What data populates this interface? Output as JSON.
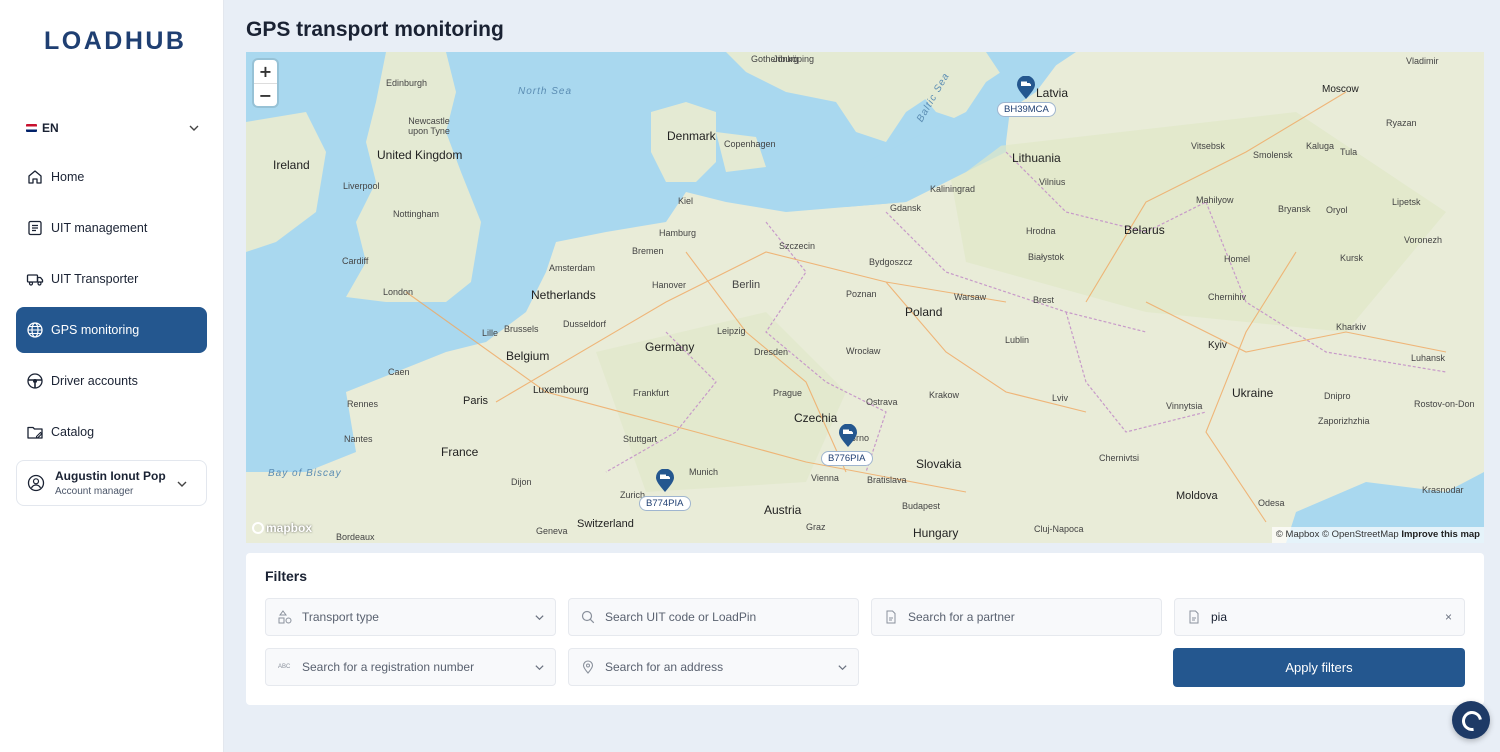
{
  "app": {
    "logo": "LOADHUB"
  },
  "language": {
    "code": "EN"
  },
  "nav": {
    "items": [
      {
        "label": "Home",
        "icon": "home-icon"
      },
      {
        "label": "UIT management",
        "icon": "document-list-icon"
      },
      {
        "label": "UIT Transporter",
        "icon": "truck-icon"
      },
      {
        "label": "GPS monitoring",
        "icon": "globe-icon",
        "active": true
      },
      {
        "label": "Driver accounts",
        "icon": "steering-wheel-icon"
      },
      {
        "label": "Catalog",
        "icon": "folder-edit-icon"
      }
    ]
  },
  "user": {
    "name": "Augustin Ionut Pop",
    "role": "Account manager"
  },
  "page": {
    "title": "GPS transport monitoring"
  },
  "map": {
    "zoom_in": "+",
    "zoom_out": "−",
    "logo": "mapbox",
    "attribution": {
      "mapbox": "© Mapbox",
      "osm": "© OpenStreetMap",
      "improve": "Improve this map"
    },
    "countries": [
      "Ireland",
      "United Kingdom",
      "Denmark",
      "Latvia",
      "Lithuania",
      "Belarus",
      "Netherlands",
      "Belgium",
      "Germany",
      "Poland",
      "Czechia",
      "Slovakia",
      "France",
      "Luxembourg",
      "Austria",
      "Switzerland",
      "Hungary",
      "Ukraine",
      "Moldova"
    ],
    "seas": [
      "North Sea",
      "Baltic Sea",
      "Bay of Biscay"
    ],
    "cities": [
      "Gothenburg",
      "Jönköping",
      "Edinburgh",
      "Newcastle upon Tyne",
      "Liverpool",
      "Nottingham",
      "Cardiff",
      "London",
      "Copenhagen",
      "Kiel",
      "Hamburg",
      "Bremen",
      "Amsterdam",
      "Hanover",
      "Berlin",
      "Szczecin",
      "Gdansk",
      "Kaliningrad",
      "Vilnius",
      "Moscow",
      "Vladimir",
      "Ryazan",
      "Tula",
      "Kaluga",
      "Smolensk",
      "Vitsebsk",
      "Mahilyow",
      "Bryansk",
      "Oryol",
      "Lipetsk",
      "Voronezh",
      "Kursk",
      "Homel",
      "Chernihiv",
      "Kyiv",
      "Kharkiv",
      "Luhansk",
      "Dnipro",
      "Zaporizhzhia",
      "Rostov-on-Don",
      "Krasnodar",
      "Odesa",
      "Vinnytsia",
      "Chernivtsi",
      "Cluj-Napoca",
      "Lviv",
      "Lublin",
      "Brest",
      "Hrodna",
      "Białystok",
      "Warsaw",
      "Poznan",
      "Bydgoszcz",
      "Wrocław",
      "Krakow",
      "Ostrava",
      "Prague",
      "Dresden",
      "Leipzig",
      "Dusseldorf",
      "Brussels",
      "Lille",
      "Frankfurt",
      "Stuttgart",
      "Munich",
      "Zurich",
      "Geneva",
      "Vienna",
      "Bratislava",
      "Graz",
      "Budapest",
      "Paris",
      "Rennes",
      "Caen",
      "Nantes",
      "Dijon",
      "Bordeaux",
      "Brno"
    ],
    "vehicles": [
      {
        "plate": "BH39MCA"
      },
      {
        "plate": "B776PIA"
      },
      {
        "plate": "B774PIA"
      }
    ]
  },
  "filters": {
    "title": "Filters",
    "transport_type": {
      "placeholder": "Transport type"
    },
    "uit_search": {
      "placeholder": "Search UIT code or LoadPin"
    },
    "partner_search": {
      "placeholder": "Search for a partner"
    },
    "text_search": {
      "value": "pia",
      "clear": "×"
    },
    "registration_search": {
      "placeholder": "Search for a registration number",
      "icon_text": "ABC"
    },
    "address_search": {
      "placeholder": "Search for an address"
    },
    "apply_label": "Apply filters"
  },
  "colors": {
    "primary": "#24578f",
    "logo": "#1f3f72",
    "sea": "#a9d8ef",
    "land": "#e9ecd8"
  }
}
